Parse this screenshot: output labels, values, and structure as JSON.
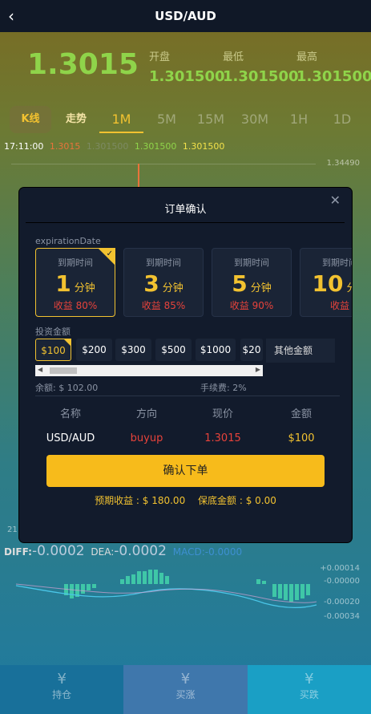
{
  "header": {
    "title": "USD/AUD",
    "back_icon": "chevron-left-icon"
  },
  "quote": {
    "price": "1.3015",
    "open_label": "开盘",
    "open_value": "1.301500",
    "low_label": "最低",
    "low_value": "1.301500",
    "high_label": "最高",
    "high_value": "1.301500"
  },
  "tabs": [
    "K线",
    "走势",
    "1M",
    "5M",
    "15M",
    "30M",
    "1H",
    "1D"
  ],
  "active_tab": "1M",
  "ticker": {
    "time": "17:11:00",
    "v1": "1.3015",
    "v2": "1.301500",
    "v3": "1.301500",
    "v4": "1.301500"
  },
  "chart_labels": {
    "top": "1.34490",
    "side_21": "21"
  },
  "indicator": {
    "diff_label": "DIFF:",
    "diff_value": "-0.0002",
    "dea_label": "DEA:",
    "dea_value": "-0.0002",
    "macd_label": "MACD:",
    "macd_value": "-0.0000"
  },
  "macd_axis": [
    "+0.00014",
    "-0.00000",
    "-0.00020",
    "-0.00034"
  ],
  "modal": {
    "title": "订单确认",
    "close_icon": "close-icon",
    "expiration_label": "expirationDate",
    "expirations": [
      {
        "label": "到期时间",
        "num": "1",
        "unit": "分钟",
        "profit": "收益 80%"
      },
      {
        "label": "到期时间",
        "num": "3",
        "unit": "分钟",
        "profit": "收益 85%"
      },
      {
        "label": "到期时间",
        "num": "5",
        "unit": "分钟",
        "profit": "收益 90%"
      },
      {
        "label": "到期时间",
        "num": "10",
        "unit": "分钟",
        "profit": "收益"
      }
    ],
    "amount_label": "投资金额",
    "amounts": [
      "$100",
      "$200",
      "$300",
      "$500",
      "$1000",
      "$20"
    ],
    "other_amount": "其他金额",
    "balance": "余额: $ 102.00",
    "fee": "手续费:  2%",
    "columns": [
      {
        "h": "名称",
        "v": "USD/AUD"
      },
      {
        "h": "方向",
        "v": "buyup"
      },
      {
        "h": "现价",
        "v": "1.3015"
      },
      {
        "h": "金额",
        "v": "$100"
      }
    ],
    "confirm": "确认下单",
    "expected": "预期收益 : $ 180.00",
    "margin": "保底金额 : $ 0.00"
  },
  "bottom_nav": [
    {
      "label": "持仓",
      "icon": "yen-coins-icon"
    },
    {
      "label": "买涨",
      "icon": "yen-circle-icon"
    },
    {
      "label": "买跌",
      "icon": "yen-circle-icon"
    }
  ]
}
